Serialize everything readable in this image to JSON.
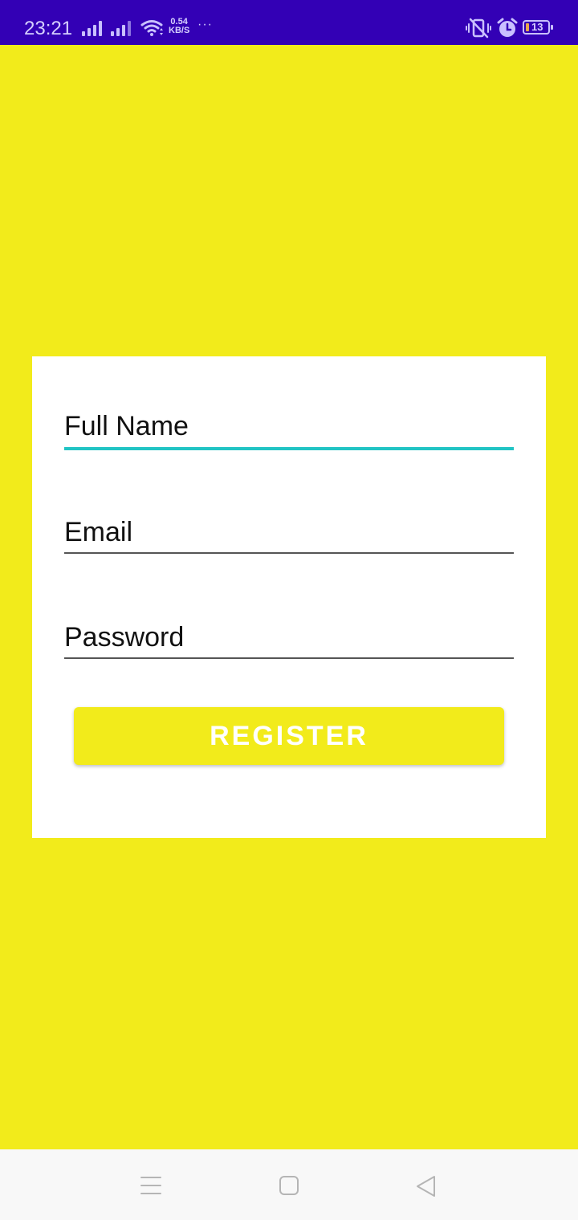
{
  "status_bar": {
    "time": "23:21",
    "net_speed_value": "0.54",
    "net_speed_unit": "KB/S",
    "more": "···",
    "battery_level": "13",
    "icons": [
      "signal-icon",
      "signal-icon",
      "wifi-icon",
      "vibrate-mute-icon",
      "alarm-icon",
      "battery-icon"
    ]
  },
  "form": {
    "full_name_label": "Full Name",
    "email_label": "Email",
    "password_label": "Password",
    "register_label": "REGISTER",
    "active_field": "full_name"
  },
  "nav_bar": {
    "icons": [
      "menu-icon",
      "home-icon",
      "back-icon"
    ]
  },
  "colors": {
    "background": "#f2eb1b",
    "status_bar": "#3300b5",
    "card": "#ffffff",
    "active_underline": "#21c4c4",
    "button": "#f2eb1b"
  }
}
